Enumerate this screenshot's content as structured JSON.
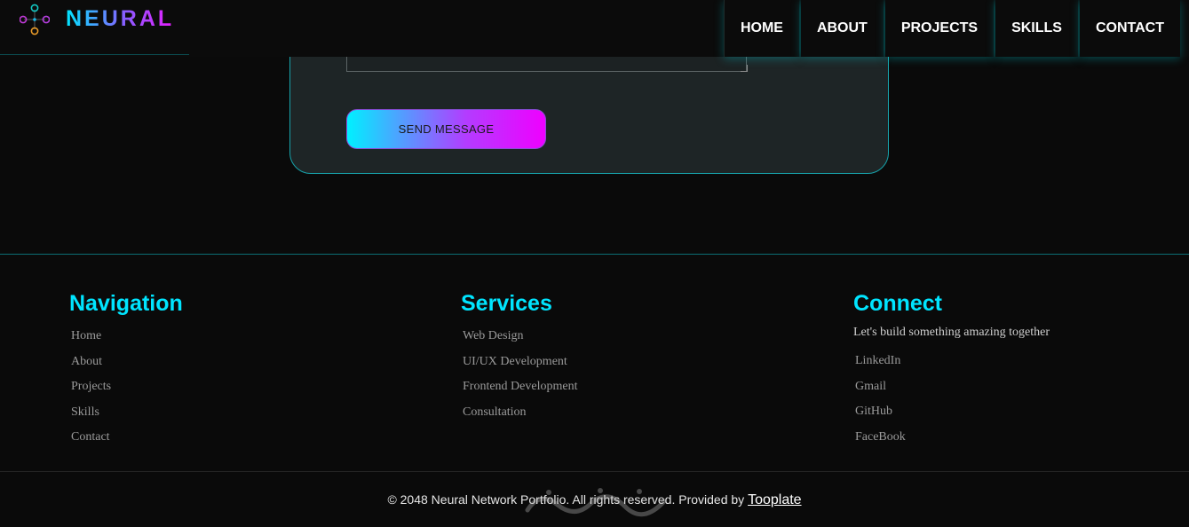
{
  "brand": {
    "name": "NEURAL"
  },
  "nav": {
    "items": [
      "HOME",
      "ABOUT",
      "PROJECTS",
      "SKILLS",
      "CONTACT"
    ]
  },
  "contact_form": {
    "message_value": "",
    "send_label": "SEND MESSAGE"
  },
  "footer": {
    "navigation": {
      "title": "Navigation",
      "links": [
        "Home",
        "About",
        "Projects",
        "Skills",
        "Contact"
      ]
    },
    "services": {
      "title": "Services",
      "links": [
        "Web Design",
        "UI/UX Development",
        "Frontend Development",
        "Consultation"
      ]
    },
    "connect": {
      "title": "Connect",
      "tagline": "Let's build something amazing together",
      "links": [
        "LinkedIn",
        "Gmail",
        "GitHub",
        "FaceBook"
      ]
    },
    "copyright_text": "© 2048 Neural Network Portfolio. All rights reserved. Provided by",
    "provider_link": "Tooplate"
  },
  "colors": {
    "accent_cyan": "#00e5ff",
    "accent_magenta": "#e81cff",
    "background": "#0a0a0a",
    "card": "#1e2526"
  }
}
